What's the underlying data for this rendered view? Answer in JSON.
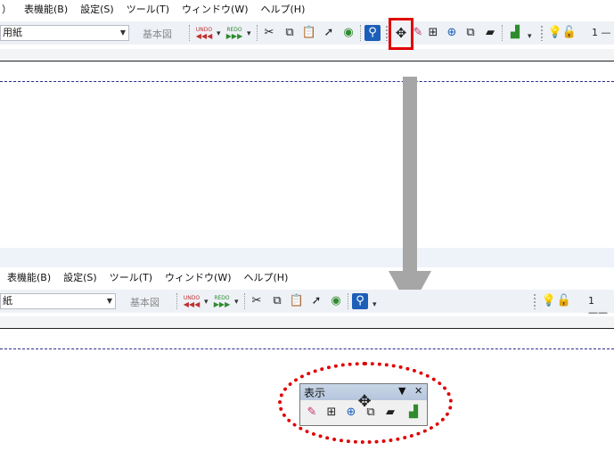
{
  "top": {
    "menu": [
      "）",
      "表機能(B)",
      "設定(S)",
      "ツール(T)",
      "ウィンドウ(W)",
      "ヘルプ(H)"
    ],
    "paper_combo": "用紙",
    "basic_button": "基本図",
    "undo_label": "UNDO",
    "redo_label": "REDO",
    "layer_value": "1 —"
  },
  "bottom": {
    "menu": [
      "表機能(B)",
      "設定(S)",
      "ツール(T)",
      "ウィンドウ(W)",
      "ヘルプ(H)"
    ],
    "paper_combo": "紙",
    "basic_button": "基本図",
    "undo_label": "UNDO",
    "redo_label": "REDO",
    "layer_value": "1 ——"
  },
  "palette": {
    "title": "表示",
    "menu_glyph": "▼",
    "close_glyph": "✕"
  },
  "icons": {
    "move": "move-icon",
    "cut": "scissors-icon",
    "copy": "copy-icon",
    "paste": "paste-icon",
    "select": "cursor-icon",
    "zoom_pen": "zoom-pen-icon",
    "search": "magnifier-icon",
    "bulb": "lightbulb-icon",
    "lock": "lock-icon"
  },
  "colors": {
    "highlight": "#e00000",
    "arrow": "#a6a6a6",
    "toolbar_bg": "#eef1f6",
    "dash_line": "#2b2b8c"
  }
}
